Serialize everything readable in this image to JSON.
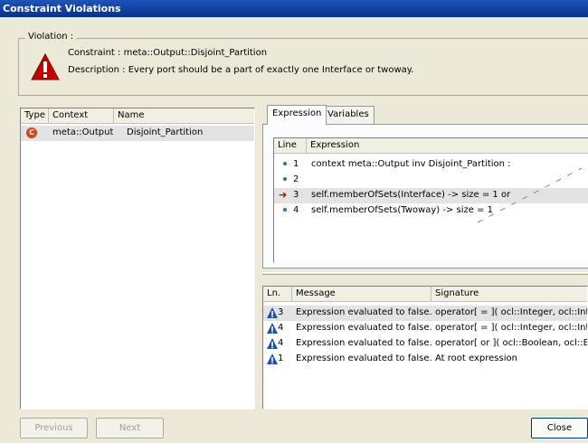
{
  "window": {
    "title": "Constraint Violations"
  },
  "violation": {
    "legend": "Violation :",
    "constraint_label": "Constraint :",
    "constraint_value": "meta::Output::Disjoint_Partition",
    "description_label": "Description :",
    "description_value": "Every port should be a part of exactly one Interface or twoway."
  },
  "violations_list": {
    "columns": [
      "Type",
      "Context",
      "Name"
    ],
    "rows": [
      {
        "type_icon": "constraint-icon",
        "type_glyph": "C",
        "context": "meta::Output",
        "name": "Disjoint_Partition",
        "selected": true
      }
    ]
  },
  "tabs": [
    {
      "label": "Expression",
      "active": true
    },
    {
      "label": "Variables",
      "active": false
    }
  ],
  "expression": {
    "columns": [
      "Line",
      "Expression"
    ],
    "rows": [
      {
        "line": "1",
        "marker": "bullet",
        "text": "context meta::Output inv Disjoint_Partition :"
      },
      {
        "line": "2",
        "marker": "bullet",
        "text": ""
      },
      {
        "line": "3",
        "marker": "arrow",
        "arrow_glyph": "➔",
        "text": "self.memberOfSets(Interface) -> size = 1 or",
        "selected": true
      },
      {
        "line": "4",
        "marker": "bullet",
        "text": "self.memberOfSets(Twoway) -> size = 1"
      }
    ]
  },
  "messages": {
    "columns": [
      "Ln.",
      "Message",
      "Signature"
    ],
    "rows": [
      {
        "ln": "3",
        "message": "Expression evaluated to false.",
        "signature": "operator[ = ]( ocl::Integer, ocl::Integ",
        "selected": true
      },
      {
        "ln": "4",
        "message": "Expression evaluated to false.",
        "signature": "operator[ = ]( ocl::Integer, ocl::Integ"
      },
      {
        "ln": "4",
        "message": "Expression evaluated to false.",
        "signature": "operator[ or ]( ocl::Boolean, ocl::Bo"
      },
      {
        "ln": "1",
        "message": "Expression evaluated to false.",
        "signature": "At root expression"
      }
    ]
  },
  "buttons": {
    "previous": "Previous",
    "next": "Next",
    "close": "Close"
  },
  "colors": {
    "title_bar": "#0a2f8e",
    "warning_icon": "#c00000",
    "info_icon": "#1f4fb4",
    "arrow": "#b00000"
  }
}
